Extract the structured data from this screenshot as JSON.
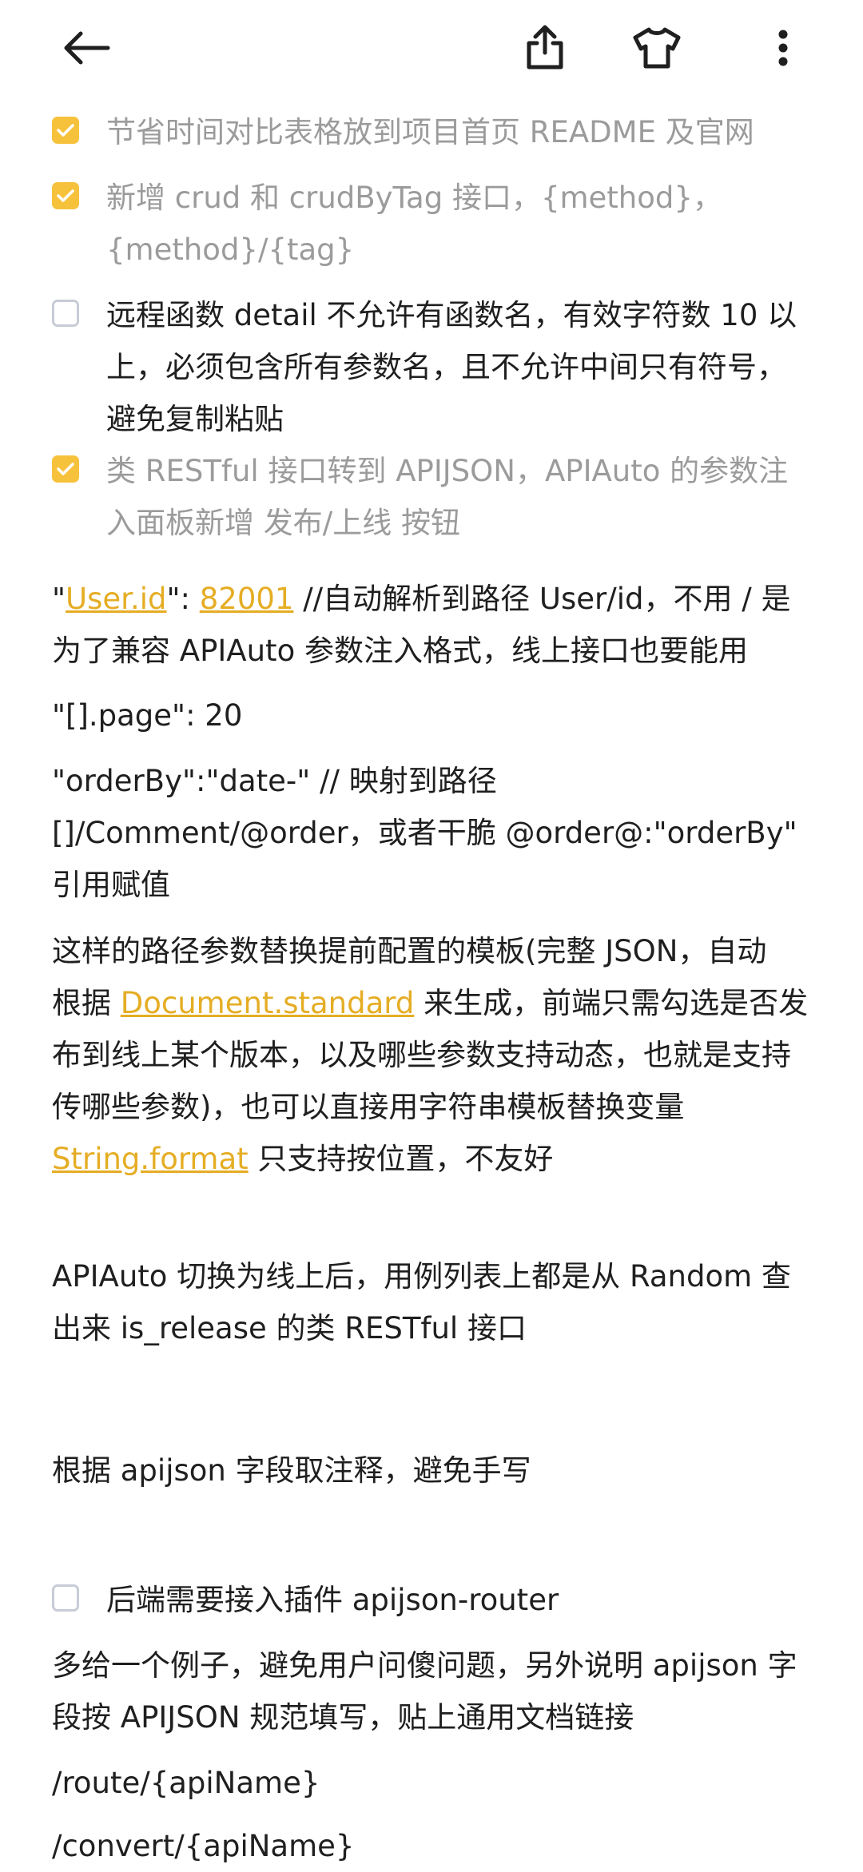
{
  "topbar": {
    "back_icon": "arrow-left-icon",
    "share_icon": "share-icon",
    "theme_icon": "tshirt-icon",
    "more_icon": "more-vertical-icon"
  },
  "colors": {
    "accent": "#f7c23b",
    "link": "#e5ad24",
    "done_text": "#9b9b9b",
    "text": "#1f1f1f",
    "unchecked_border": "#c7ccd6"
  },
  "tasks": [
    {
      "checked": true,
      "lines": [
        "节省时间对比表格放到项目首页 README 及官网"
      ]
    },
    {
      "checked": true,
      "lines": [
        "新增 crud 和 crudByTag 接口，{method}，",
        "{method}/{tag}"
      ]
    },
    {
      "checked": false,
      "lines": [
        "远程函数 detail 不允许有函数名，有效字符数 10 以",
        "上，必须包含所有参数名，且不允许中间只有符号，",
        "避免复制粘贴"
      ]
    },
    {
      "checked": true,
      "lines": [
        "类 RESTful 接口转到 APIJSON，APIAuto 的参数注",
        "入面板新增 发布/上线 按钮"
      ]
    }
  ],
  "para_userid": {
    "q1": "\"",
    "link_key": "User.id",
    "mid": "\": ",
    "link_val": "82001",
    "rest1": "  //自动解析到路径 User/id，不用 / 是",
    "line2": "为了兼容 APIAuto 参数注入格式，线上接口也要能用"
  },
  "para_page": "\"[].page\": 20",
  "para_order": [
    "\"orderBy\":\"date-\"  // 映射到路径",
    "[]/Comment/@order，或者干脆  @order@:\"orderBy\"",
    "引用赋值"
  ],
  "para_template": {
    "line1": "这样的路径参数替换提前配置的模板(完整 JSON，自动",
    "line2_pre": "根据 ",
    "line2_link": "Document.standard",
    "line2_post": " 来生成，前端只需勾选是否发",
    "line3": "布到线上某个版本，以及哪些参数支持动态，也就是支持",
    "line4": "传哪些参数)，也可以直接用字符串模板替换变量",
    "line5_link": "String.format",
    "line5_post": " 只支持按位置，不友好"
  },
  "para_apiauto": [
    "APIAuto 切换为线上后，用例列表上都是从 Random 查",
    "出来 is_release 的类 RESTful 接口"
  ],
  "para_apijson": "根据 apijson 字段取注释，避免手写",
  "task_router": {
    "checked": false,
    "text": "后端需要接入插件 apijson-router"
  },
  "para_example": [
    "多给一个例子，避免用户问傻问题，另外说明 apijson 字",
    "段按 APIJSON 规范填写，贴上通用文档链接"
  ],
  "para_route": "/route/{apiName}",
  "para_convert": "/convert/{apiName}"
}
